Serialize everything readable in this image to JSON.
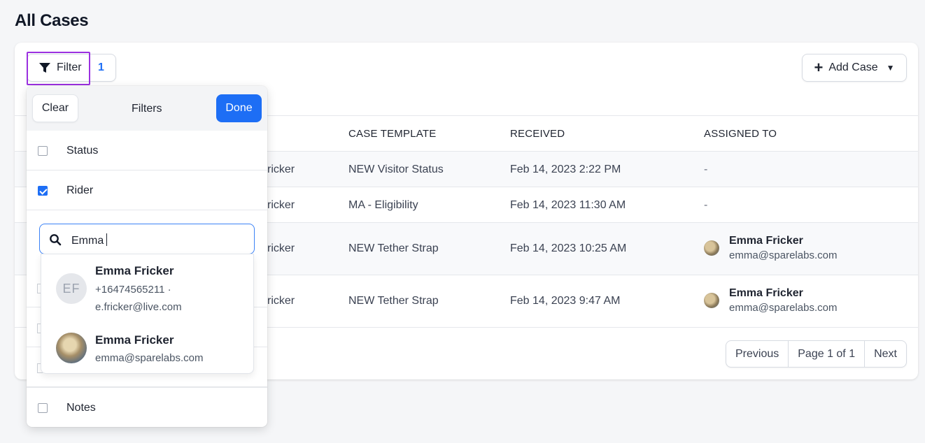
{
  "page": {
    "title": "All Cases"
  },
  "toolbar": {
    "filter_label": "Filter",
    "filter_count": "1",
    "add_case_label": "Add Case",
    "add_case_plus": "+"
  },
  "table": {
    "headers": [
      "CASE TEMPLATE",
      "RECEIVED",
      "ASSIGNED TO"
    ],
    "rows": [
      {
        "rider_partial": "ricker",
        "template": "NEW Visitor Status",
        "received": "Feb 14, 2023 2:22 PM",
        "assigned": "-"
      },
      {
        "rider_partial": "ricker",
        "template": "MA - Eligibility",
        "received": "Feb 14, 2023 11:30 AM",
        "assigned": "-"
      },
      {
        "rider_partial": "ricker",
        "template": "NEW Tether Strap",
        "received": "Feb 14, 2023 10:25 AM",
        "assigned_name": "Emma Fricker",
        "assigned_email": "emma@sparelabs.com"
      },
      {
        "rider_partial": "ricker",
        "template": "NEW Tether Strap",
        "received": "Feb 14, 2023 9:47 AM",
        "assigned_name": "Emma Fricker",
        "assigned_email": "emma@sparelabs.com"
      }
    ]
  },
  "pagination": {
    "previous": "Previous",
    "page": "Page 1 of 1",
    "next": "Next"
  },
  "filter_panel": {
    "clear_label": "Clear",
    "title": "Filters",
    "done_label": "Done",
    "items": [
      {
        "label": "Status",
        "checked": false
      },
      {
        "label": "Rider",
        "checked": true
      },
      {
        "label": "Notes",
        "checked": false
      }
    ],
    "search_value": "Emma",
    "results": [
      {
        "initials": "EF",
        "name": "Emma Fricker",
        "detail_line1": "+16474565211 ·",
        "detail_line2": "e.fricker@live.com"
      },
      {
        "name": "Emma Fricker",
        "detail_line1": "emma@sparelabs.com"
      }
    ]
  },
  "colors": {
    "accent": "#1d6ef5",
    "highlight": "#9b30e0"
  }
}
